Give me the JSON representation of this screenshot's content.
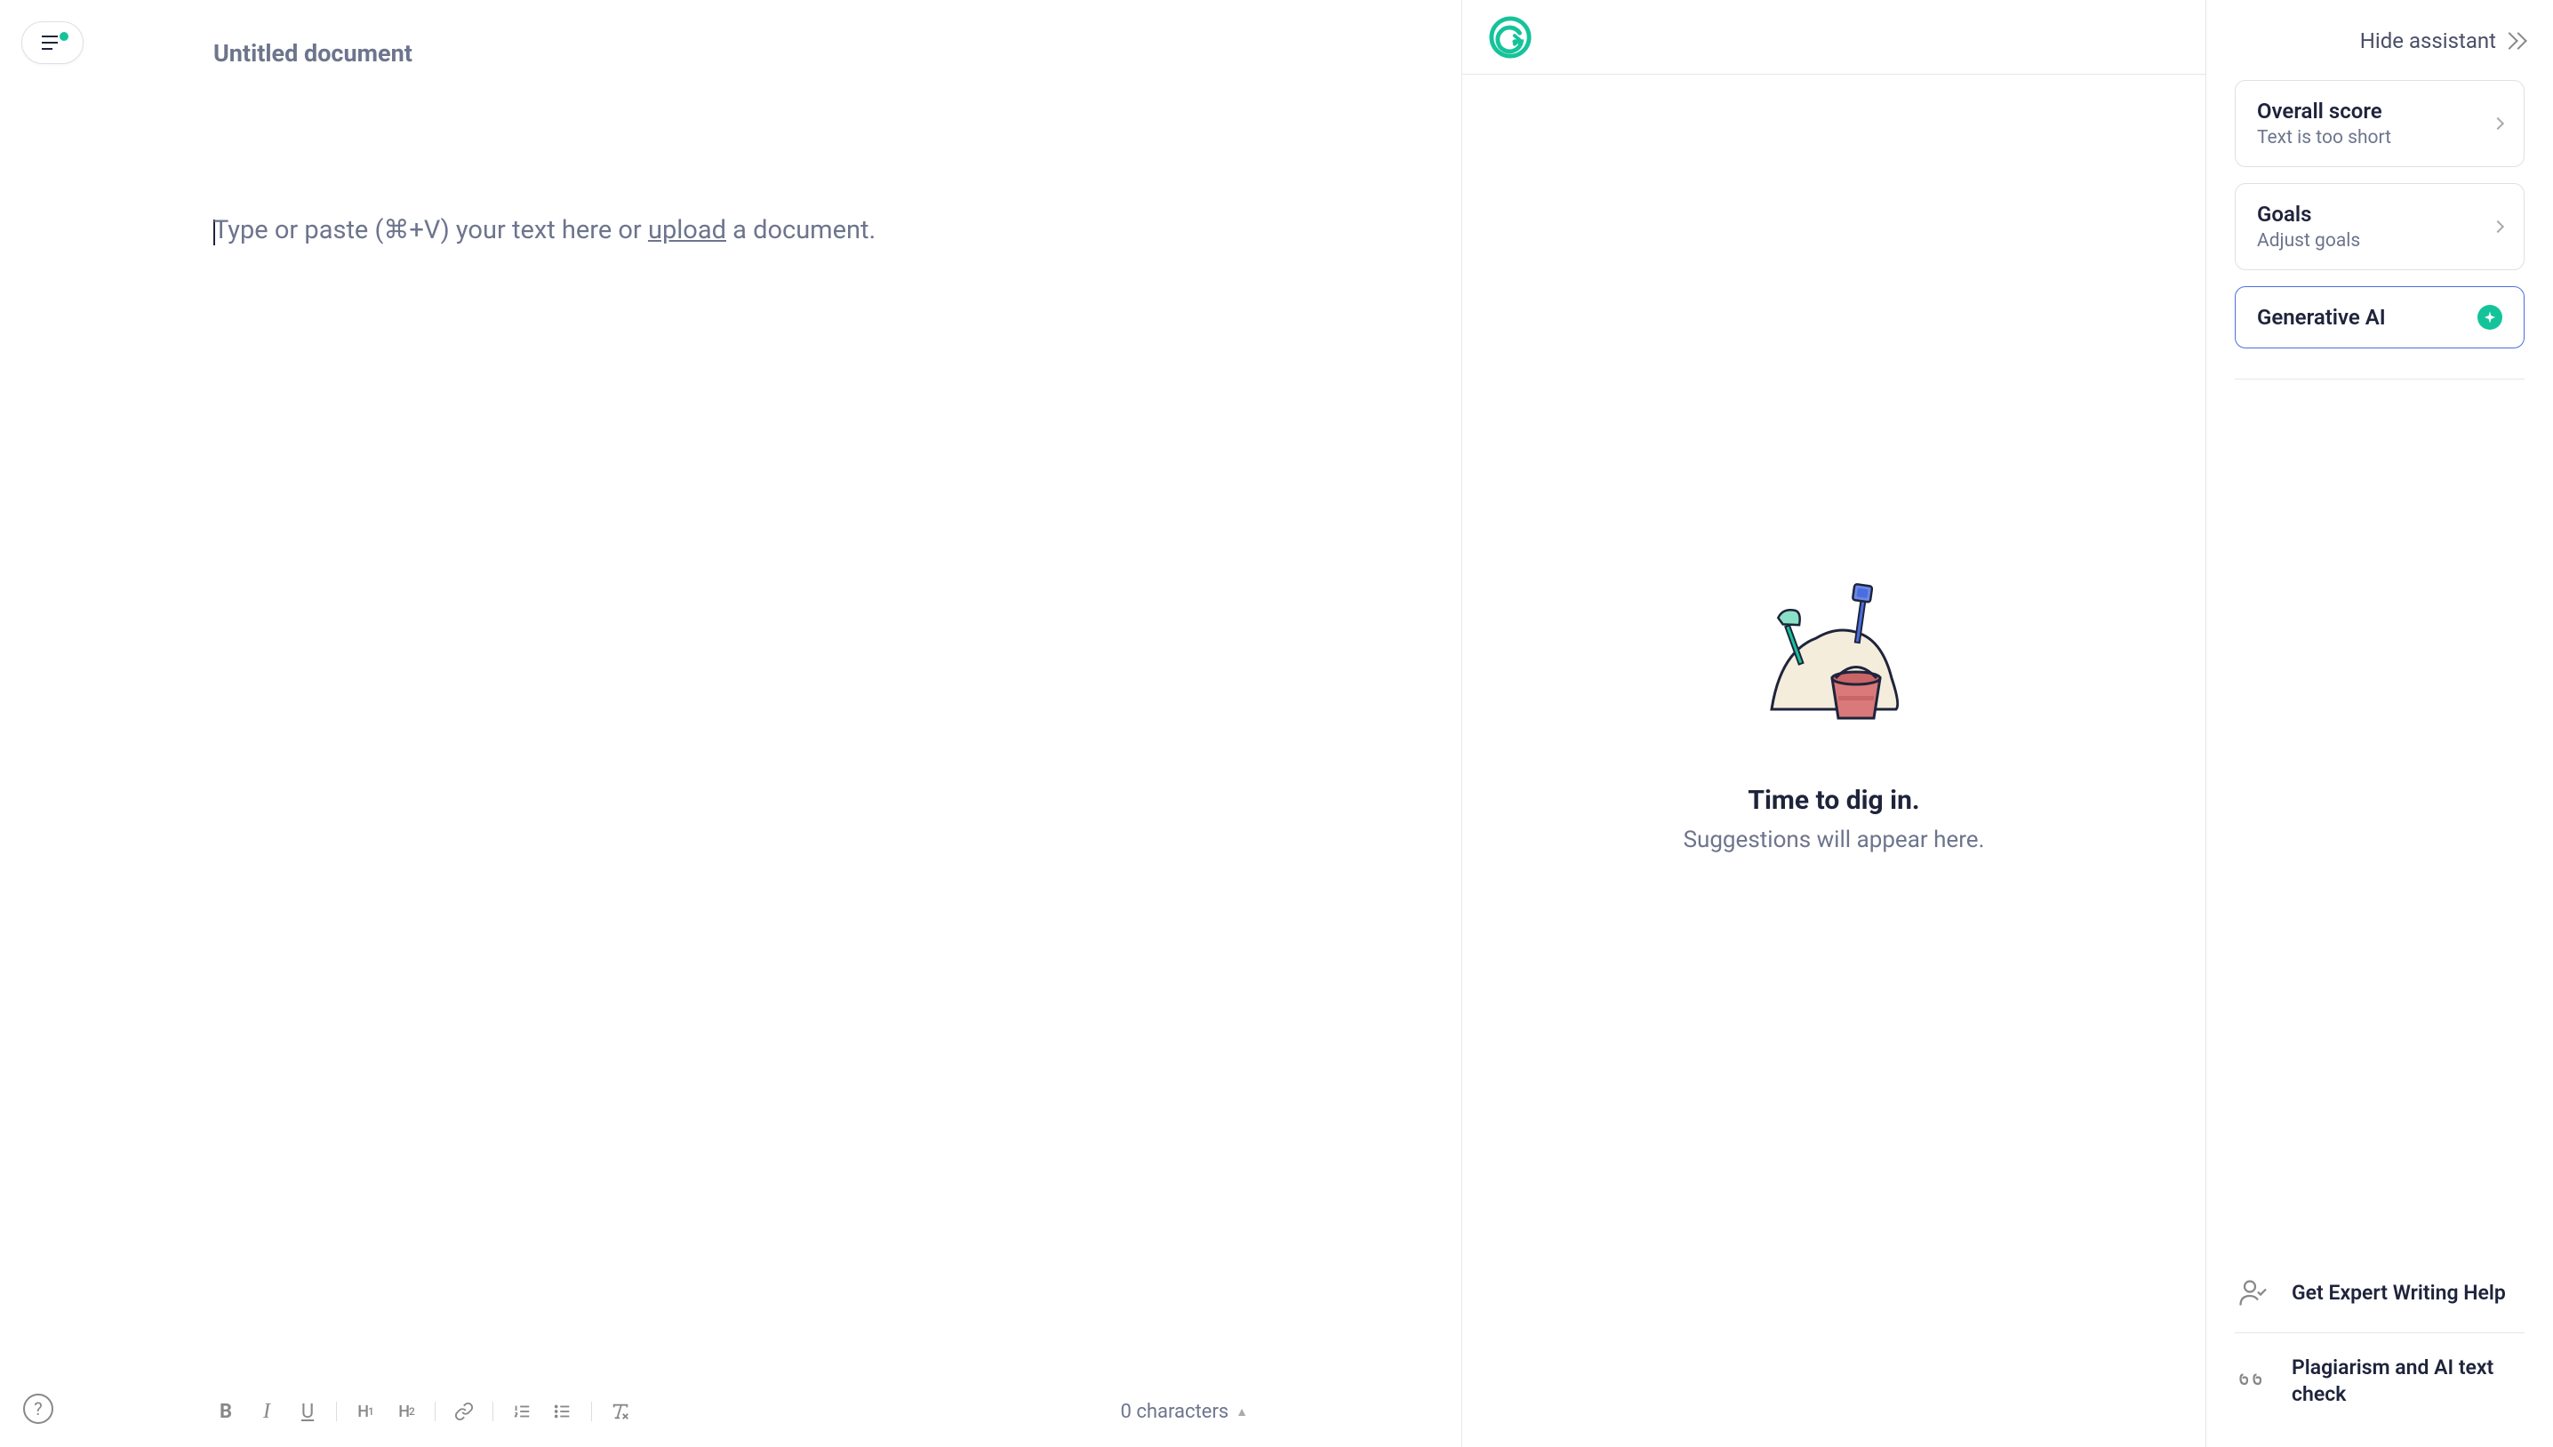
{
  "document": {
    "title": "Untitled document",
    "placeholder_pre": "Type or paste (⌘+V) your text here or ",
    "placeholder_upload": "upload",
    "placeholder_post": " a document."
  },
  "toolbar": {
    "bold": "B",
    "italic": "I",
    "underline": "U",
    "h1": "H1",
    "h2": "H2",
    "char_count": "0 characters"
  },
  "suggestions": {
    "empty_title": "Time to dig in.",
    "empty_subtitle": "Suggestions will appear here."
  },
  "sidebar": {
    "hide_label": "Hide assistant",
    "cards": {
      "score": {
        "title": "Overall score",
        "subtitle": "Text is too short"
      },
      "goals": {
        "title": "Goals",
        "subtitle": "Adjust goals"
      },
      "genai": {
        "title": "Generative AI"
      }
    },
    "bottom": {
      "expert": "Get Expert Writing Help",
      "plagiarism": "Plagiarism and AI text check"
    }
  }
}
